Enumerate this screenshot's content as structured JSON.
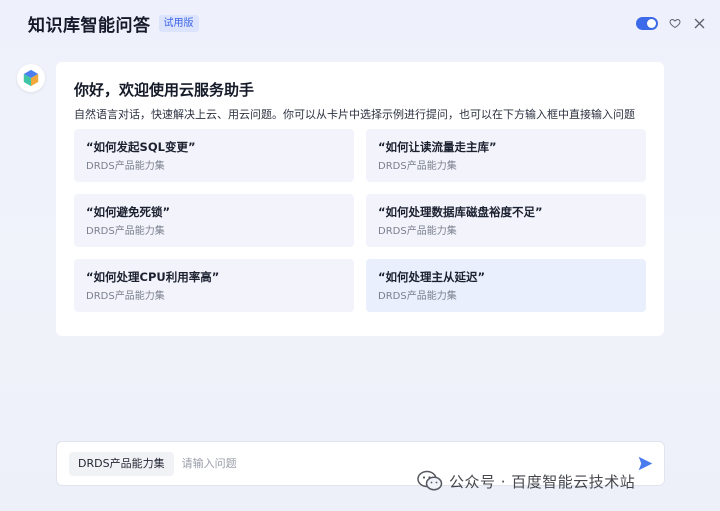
{
  "header": {
    "title": "知识库智能问答",
    "badge": "试用版",
    "toggle_on": true,
    "icons": [
      "toggle-switch",
      "heart-icon",
      "close-icon"
    ]
  },
  "colors": {
    "accent": "#3d6ae8",
    "badge_bg": "#dbe4fc",
    "card_bg": "#f3f4fb"
  },
  "welcome": {
    "title": "你好，欢迎使用云服务助手",
    "subtitle": "自然语言对话，快速解决上云、用云问题。你可以从卡片中选择示例进行提问，也可以在下方输入框中直接输入问题",
    "cards": [
      {
        "question": "“如何发起SQL变更”",
        "tag": "DRDS产品能力集"
      },
      {
        "question": "“如何让读流量走主库”",
        "tag": "DRDS产品能力集"
      },
      {
        "question": "“如何避免死锁”",
        "tag": "DRDS产品能力集"
      },
      {
        "question": "“如何处理数据库磁盘裕度不足”",
        "tag": "DRDS产品能力集"
      },
      {
        "question": "“如何处理CPU利用率高”",
        "tag": "DRDS产品能力集"
      },
      {
        "question": "“如何处理主从延迟”",
        "tag": "DRDS产品能力集"
      }
    ]
  },
  "input": {
    "scope": "DRDS产品能力集",
    "placeholder": "请输入问题",
    "value": ""
  },
  "watermark": {
    "text": "公众号 · 百度智能云技术站"
  }
}
